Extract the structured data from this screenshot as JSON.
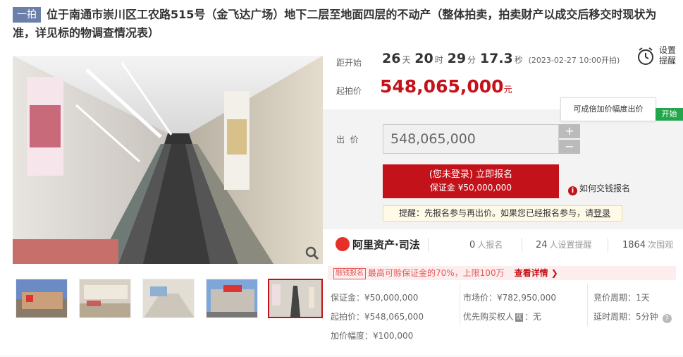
{
  "title": {
    "badge": "一拍",
    "text": "位于南通市崇川区工农路515号（金飞达广场）地下二层至地面四层的不动产（整体拍卖，拍卖财产以成交后移交时现状为准，详见标的物调查情况表）"
  },
  "countdown": {
    "label": "距开始",
    "days": "26",
    "days_unit": "天",
    "hours": "20",
    "hours_unit": "时",
    "minutes": "29",
    "minutes_unit": "分",
    "seconds": "17.3",
    "seconds_unit": "秒",
    "start_time": "(2023-02-27 10:00开拍)"
  },
  "start_price": {
    "label": "起拍价",
    "value": "548,065,000",
    "unit": "元"
  },
  "reminder": {
    "label": "设置提醒",
    "icon": "alarm-clock-icon"
  },
  "tooltip": "可成倍加价幅度出价",
  "green_tag": "开始",
  "bid": {
    "label": "出  价",
    "value": "548,065,000",
    "plus": "+",
    "minus": "−"
  },
  "signup": {
    "line1": "(您未登录) 立即报名",
    "line2": "保证金 ¥50,000,000"
  },
  "howpay": {
    "icon": "i",
    "label": "如何交钱报名"
  },
  "hint": {
    "prefix": "提醒：先报名参与再出价。如果您已经报名参与，请",
    "link": "登录"
  },
  "platform": {
    "logo": "阿里资产·司法"
  },
  "stats": [
    {
      "value": "0",
      "unit": "人报名"
    },
    {
      "value": "24",
      "unit": "人设置提醒"
    },
    {
      "value": "1864",
      "unit": "次围观"
    }
  ],
  "promo": {
    "tag": "融钱报名",
    "text": "最高可赊保证金的70%，上限100万",
    "more": "查看详情 ❯"
  },
  "info": {
    "deposit": "保证金：¥50,000,000",
    "start_price": "起拍价：¥548,065,000",
    "increment": "加价幅度：¥100,000",
    "market_price": "市场价：¥782,950,000",
    "priority_prefix": "优先购买权人",
    "priority_badge": "优",
    "priority_value": "：无",
    "cycle": "竞价周期：1天",
    "delay": "延时周期：5分钟",
    "help": "?"
  }
}
